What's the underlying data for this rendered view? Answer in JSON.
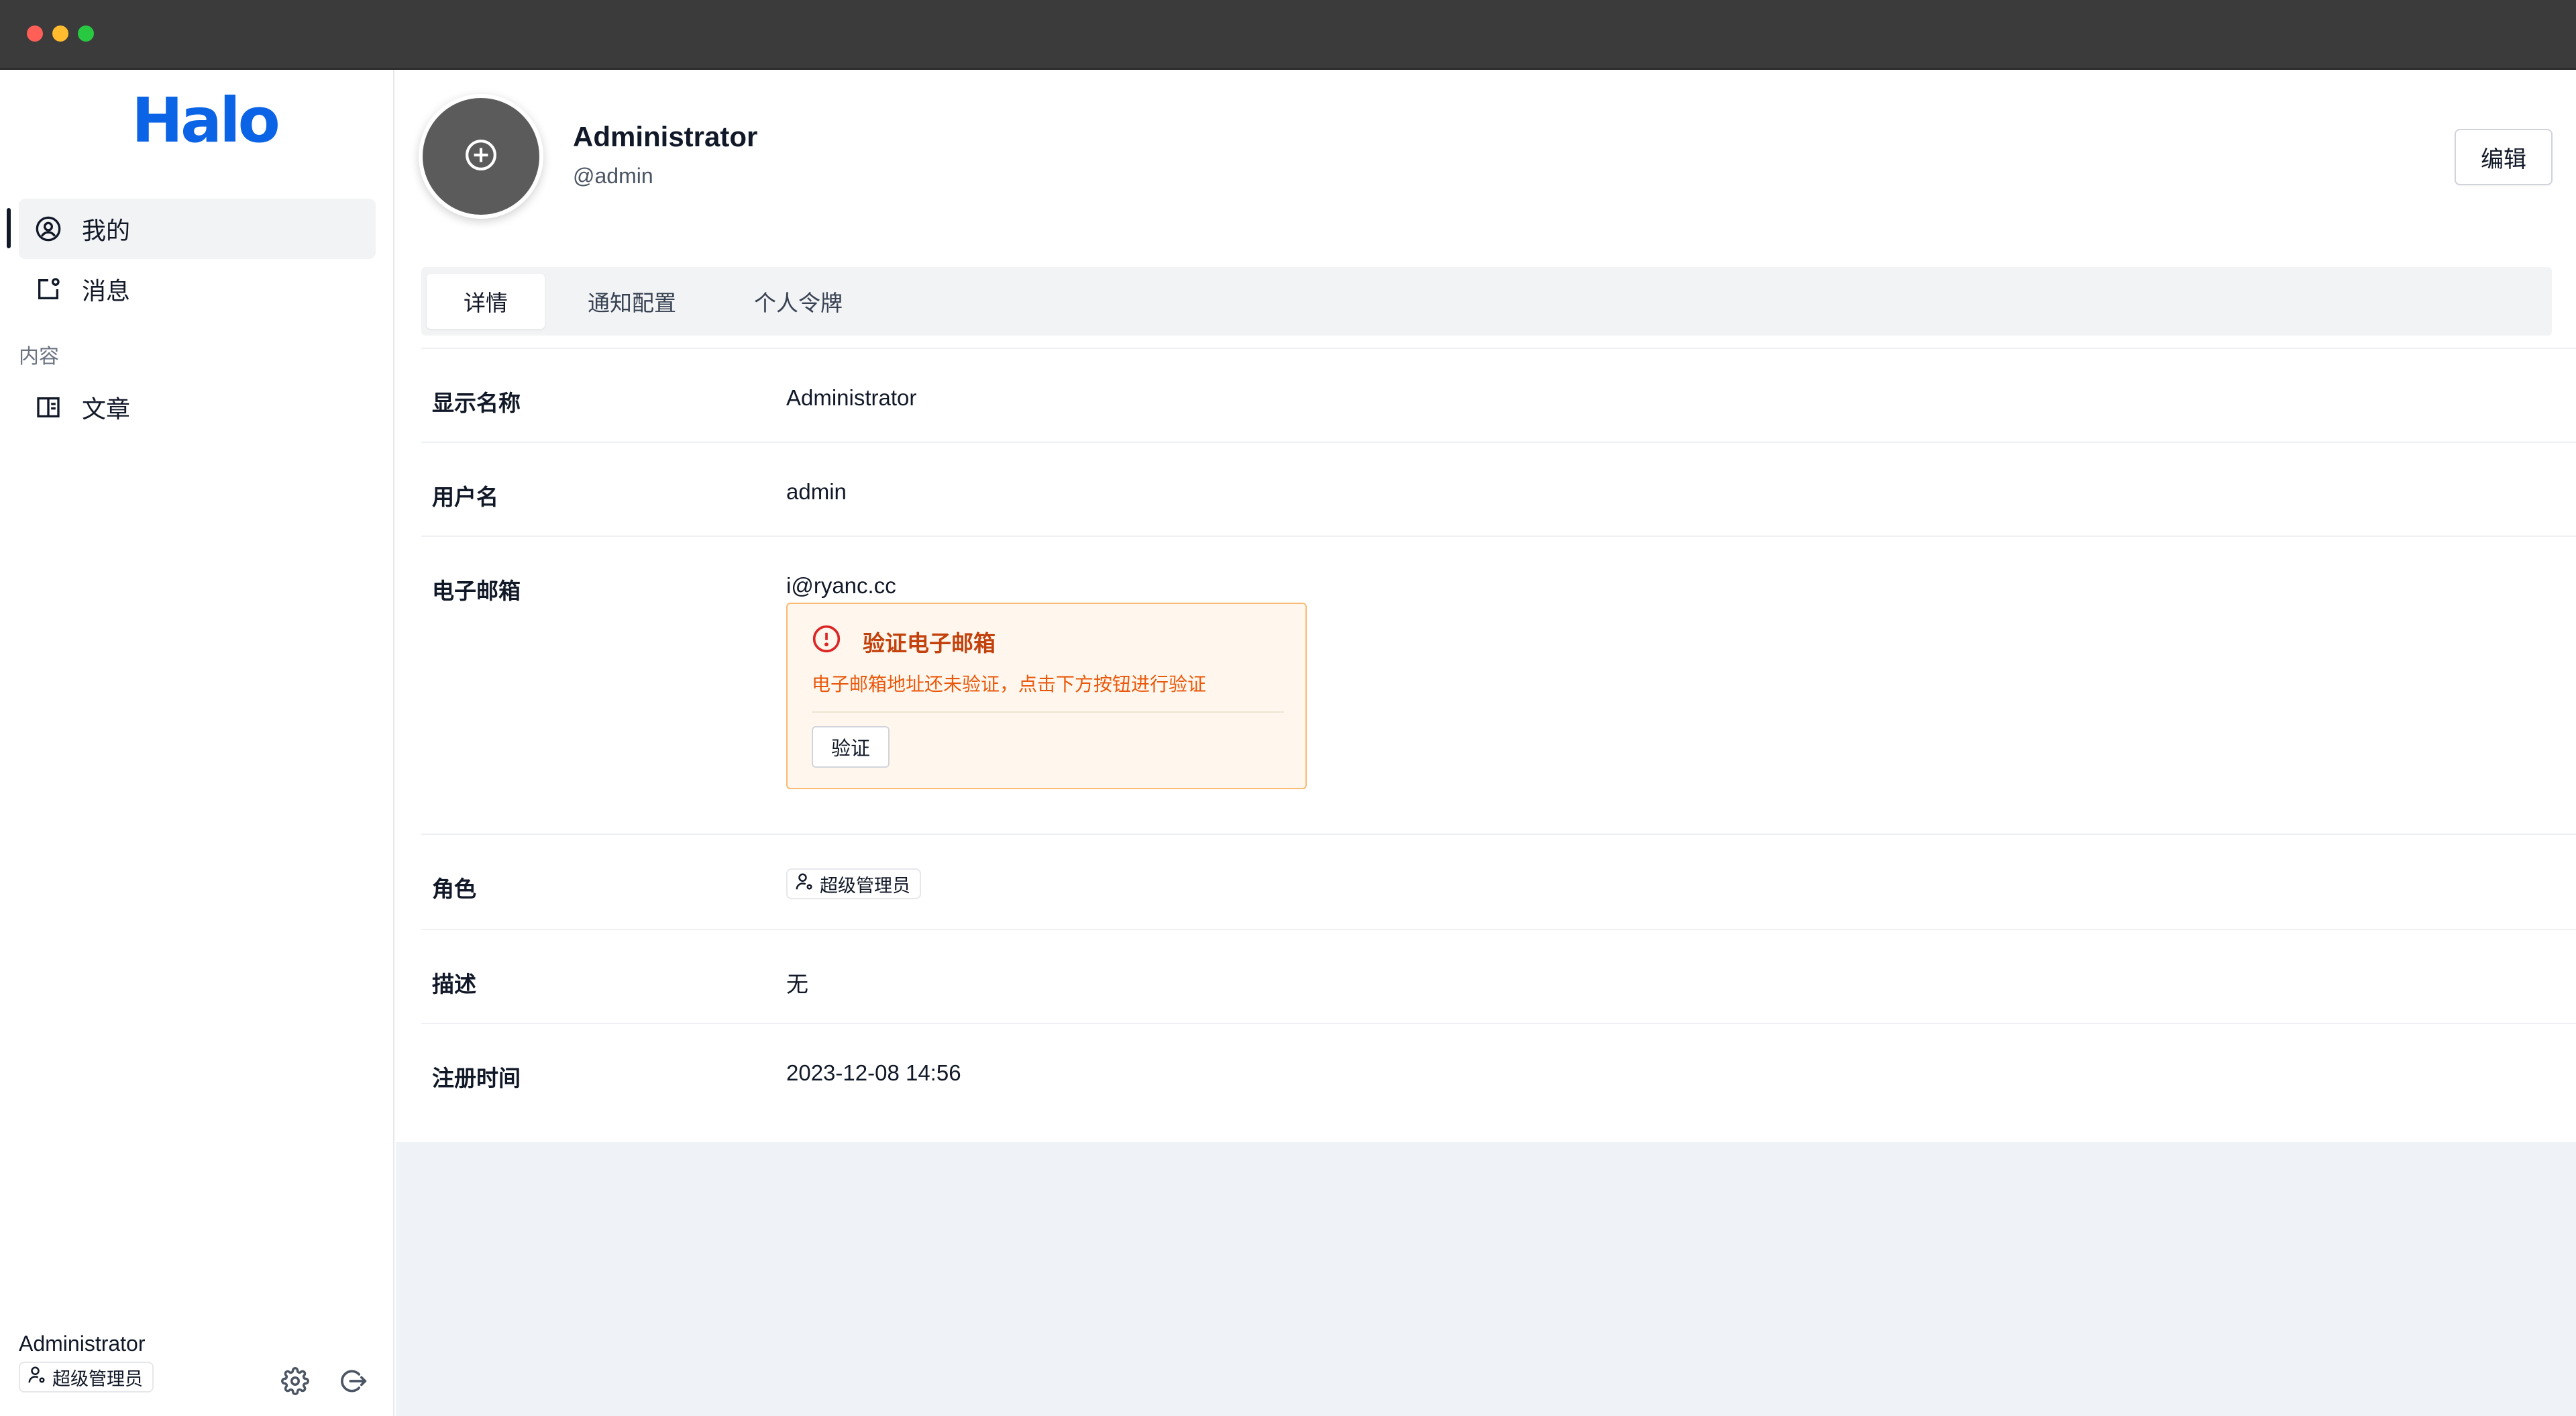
{
  "app": {
    "logo": "Halo"
  },
  "sidebar": {
    "items": [
      {
        "label": "我的",
        "icon": "user-circle-icon",
        "active": true
      },
      {
        "label": "消息",
        "icon": "notification-icon",
        "active": false
      }
    ],
    "section_label": "内容",
    "content_items": [
      {
        "label": "文章",
        "icon": "book-icon",
        "active": false
      }
    ],
    "footer": {
      "user_name": "Administrator",
      "role": "超级管理员",
      "settings_icon": "gear-icon",
      "logout_icon": "logout-icon"
    }
  },
  "profile": {
    "display_name": "Administrator",
    "handle": "@admin",
    "avatar_icon": "plus-circle-icon",
    "edit_label": "编辑"
  },
  "tabs": [
    {
      "label": "详情",
      "active": true
    },
    {
      "label": "通知配置",
      "active": false
    },
    {
      "label": "个人令牌",
      "active": false
    }
  ],
  "details": {
    "display_name": {
      "label": "显示名称",
      "value": "Administrator"
    },
    "username": {
      "label": "用户名",
      "value": "admin"
    },
    "email": {
      "label": "电子邮箱",
      "value": "i@ryanc.cc",
      "alert": {
        "icon": "alert-circle-icon",
        "title": "验证电子邮箱",
        "description": "电子邮箱地址还未验证，点击下方按钮进行验证",
        "button": "验证"
      }
    },
    "role": {
      "label": "角色",
      "value": "超级管理员"
    },
    "description": {
      "label": "描述",
      "value": "无"
    },
    "created_at": {
      "label": "注册时间",
      "value": "2023-12-08 14:56"
    }
  },
  "colors": {
    "brand": "#0b63e5",
    "alert_text": "#c2410c",
    "alert_bg": "#fff7ed",
    "alert_border": "#fdba74"
  }
}
